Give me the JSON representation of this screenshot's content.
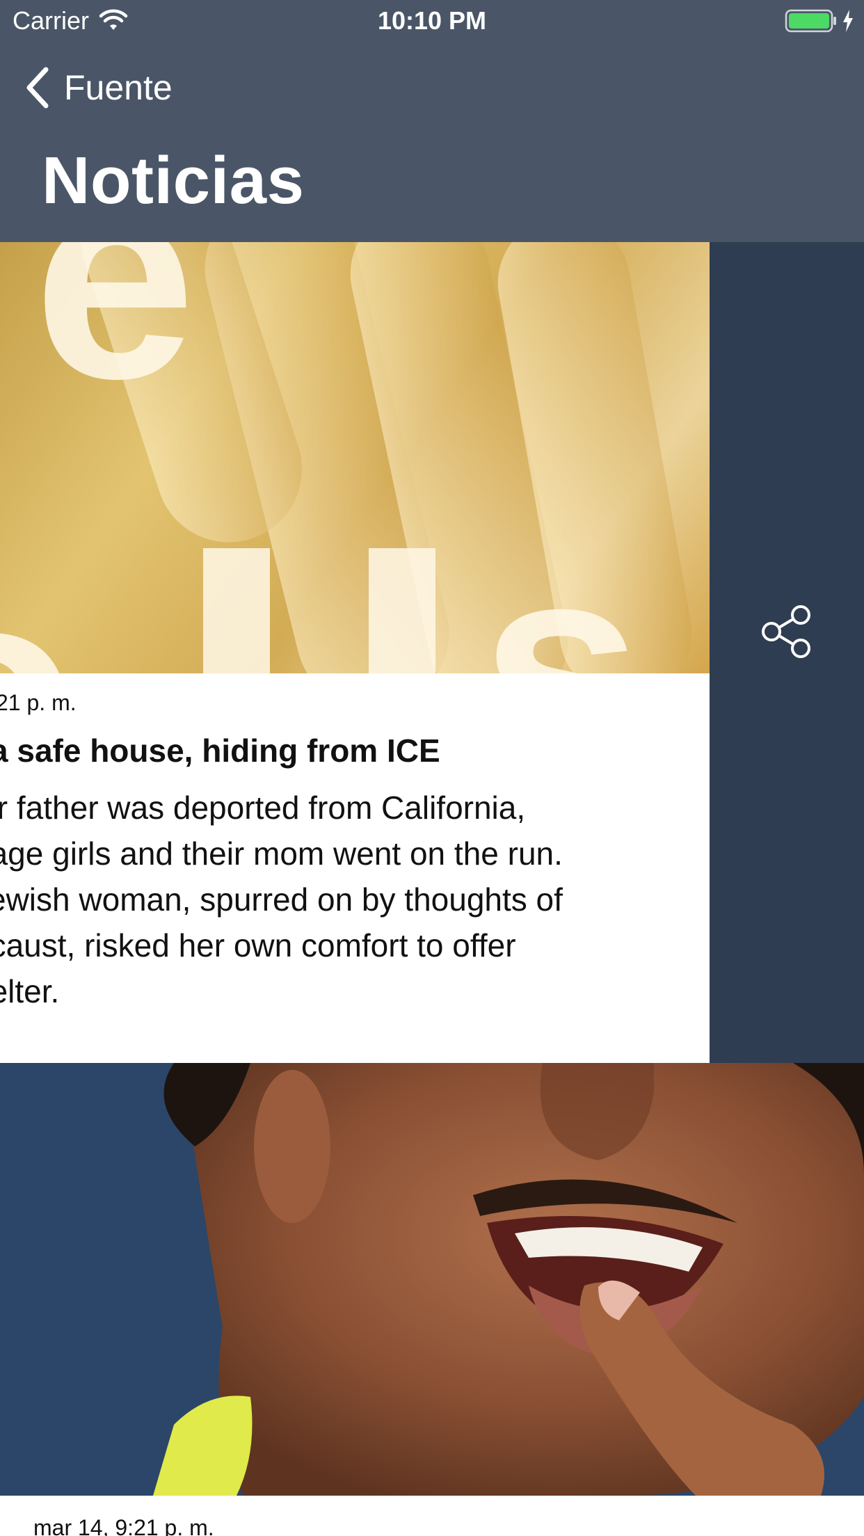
{
  "status_bar": {
    "carrier": "Carrier",
    "time": "10:10 PM",
    "icons": [
      "wifi-icon",
      "battery-icon",
      "charging-bolt-icon"
    ]
  },
  "nav": {
    "back_label": "Fuente",
    "title": "Noticias"
  },
  "cards": [
    {
      "date": "21 p. m.",
      "headline": "a safe house, hiding from ICE",
      "summary_lines": [
        "eir father was deported from California,",
        "nage girls and their mom went on the run.",
        "Jewish woman, spurred on by thoughts of",
        "ocaust, risked her own comfort to offer",
        "helter."
      ],
      "swipe_action": "share-icon"
    },
    {
      "date": "mar 14, 9:21 p. m."
    }
  ],
  "colors": {
    "nav_background": "#4a5667",
    "share_action_background": "#2f3d52",
    "text": "#111111"
  }
}
